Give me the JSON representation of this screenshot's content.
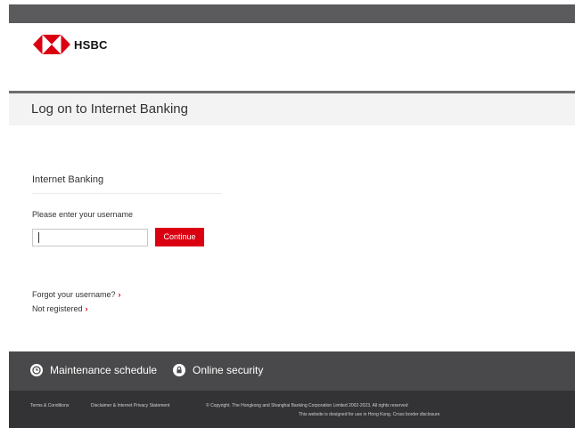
{
  "brand": {
    "name": "HSBC"
  },
  "page": {
    "title": "Log on to Internet Banking"
  },
  "login": {
    "section_title": "Internet Banking",
    "prompt": "Please enter your username",
    "username_value": "",
    "continue_label": "Continue"
  },
  "help_links": {
    "forgot": "Forgot your username?",
    "register": "Not registered"
  },
  "footer": {
    "maintenance": "Maintenance schedule",
    "security": "Online security",
    "terms": "Terms & Conditions",
    "disclaimer": "Disclaimer & Internet Privacy Statement",
    "copyright": "© Copyright. The Hongkong and Shanghai Banking Corporation Limited 2002-2023. All rights reserved",
    "usage_note": "This website is designed for use in Hong Kong. Cross border disclosure"
  },
  "colors": {
    "brand_red": "#db0011",
    "footer_top": "#49494b",
    "footer_bottom": "#333335",
    "top_bar": "#5b5b5e"
  }
}
